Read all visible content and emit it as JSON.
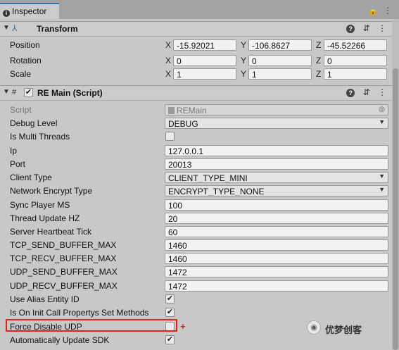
{
  "tab": {
    "title": "Inspector",
    "icons": "🔒 ⋮"
  },
  "transform": {
    "title": "Transform",
    "rows": [
      {
        "label": "Position",
        "x": "-15.92021",
        "y": "-106.8627",
        "z": "-45.52266"
      },
      {
        "label": "Rotation",
        "x": "0",
        "y": "0",
        "z": "0"
      },
      {
        "label": "Scale",
        "x": "1",
        "y": "1",
        "z": "1"
      }
    ],
    "axes": [
      "X",
      "Y",
      "Z"
    ]
  },
  "component": {
    "title": "RE Main (Script)",
    "script_label": "Script",
    "script_value": "REMain",
    "fields": {
      "debug_level": {
        "label": "Debug Level",
        "value": "DEBUG"
      },
      "multi_threads": {
        "label": "Is Multi Threads"
      },
      "ip": {
        "label": "Ip",
        "value": "127.0.0.1"
      },
      "port": {
        "label": "Port",
        "value": "20013"
      },
      "client_type": {
        "label": "Client Type",
        "value": "CLIENT_TYPE_MINI"
      },
      "encrypt": {
        "label": "Network Encrypt Type",
        "value": "ENCRYPT_TYPE_NONE"
      },
      "sync_ms": {
        "label": "Sync Player MS",
        "value": "100"
      },
      "thread_hz": {
        "label": "Thread Update HZ",
        "value": "20"
      },
      "heartbeat": {
        "label": "Server Heartbeat Tick",
        "value": "60"
      },
      "tcp_send": {
        "label": "TCP_SEND_BUFFER_MAX",
        "value": "1460"
      },
      "tcp_recv": {
        "label": "TCP_RECV_BUFFER_MAX",
        "value": "1460"
      },
      "udp_send": {
        "label": "UDP_SEND_BUFFER_MAX",
        "value": "1472"
      },
      "udp_recv": {
        "label": "UDP_RECV_BUFFER_MAX",
        "value": "1472"
      },
      "alias": {
        "label": "Use Alias Entity ID"
      },
      "init_call": {
        "label": "Is On Init Call Propertys Set Methods"
      },
      "force_udp": {
        "label": "Force Disable UDP"
      },
      "auto_sdk": {
        "label": "Automatically Update SDK"
      }
    }
  },
  "annotation": {
    "plus": "+"
  },
  "watermark": {
    "text": "优梦创客"
  },
  "colors": {
    "highlight": "#e2231a",
    "tab_accent": "#3a72b0"
  }
}
